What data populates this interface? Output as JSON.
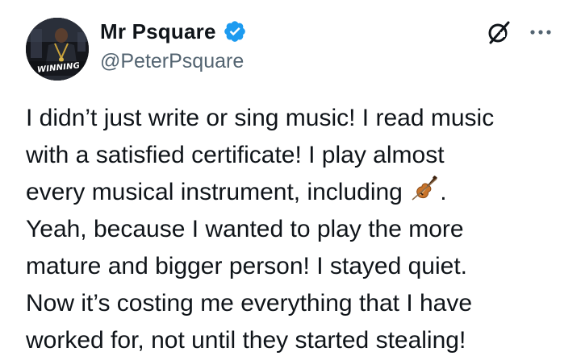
{
  "author": {
    "display_name": "Mr Psquare",
    "handle": "@PeterPsquare",
    "verified": true,
    "avatar_text": "WINNING"
  },
  "tweet": {
    "lines": [
      "I didn’t just write or sing music! I read music",
      "with a satisfied certificate! I play almost",
      "every musical instrument, including",
      ".",
      "Yeah, because I wanted to play the more",
      "mature and bigger person! I stayed quiet.",
      "Now it’s costing me everything that I have",
      "worked for, not until they started stealing!"
    ],
    "emoji": "violin-icon"
  },
  "colors": {
    "text": "#0f1419",
    "secondary_text": "#536471",
    "verified_blue": "#1d9bf0"
  },
  "icons": {
    "verified": "verified-badge-icon",
    "grok": "grok-icon",
    "more": "more-options-icon"
  }
}
